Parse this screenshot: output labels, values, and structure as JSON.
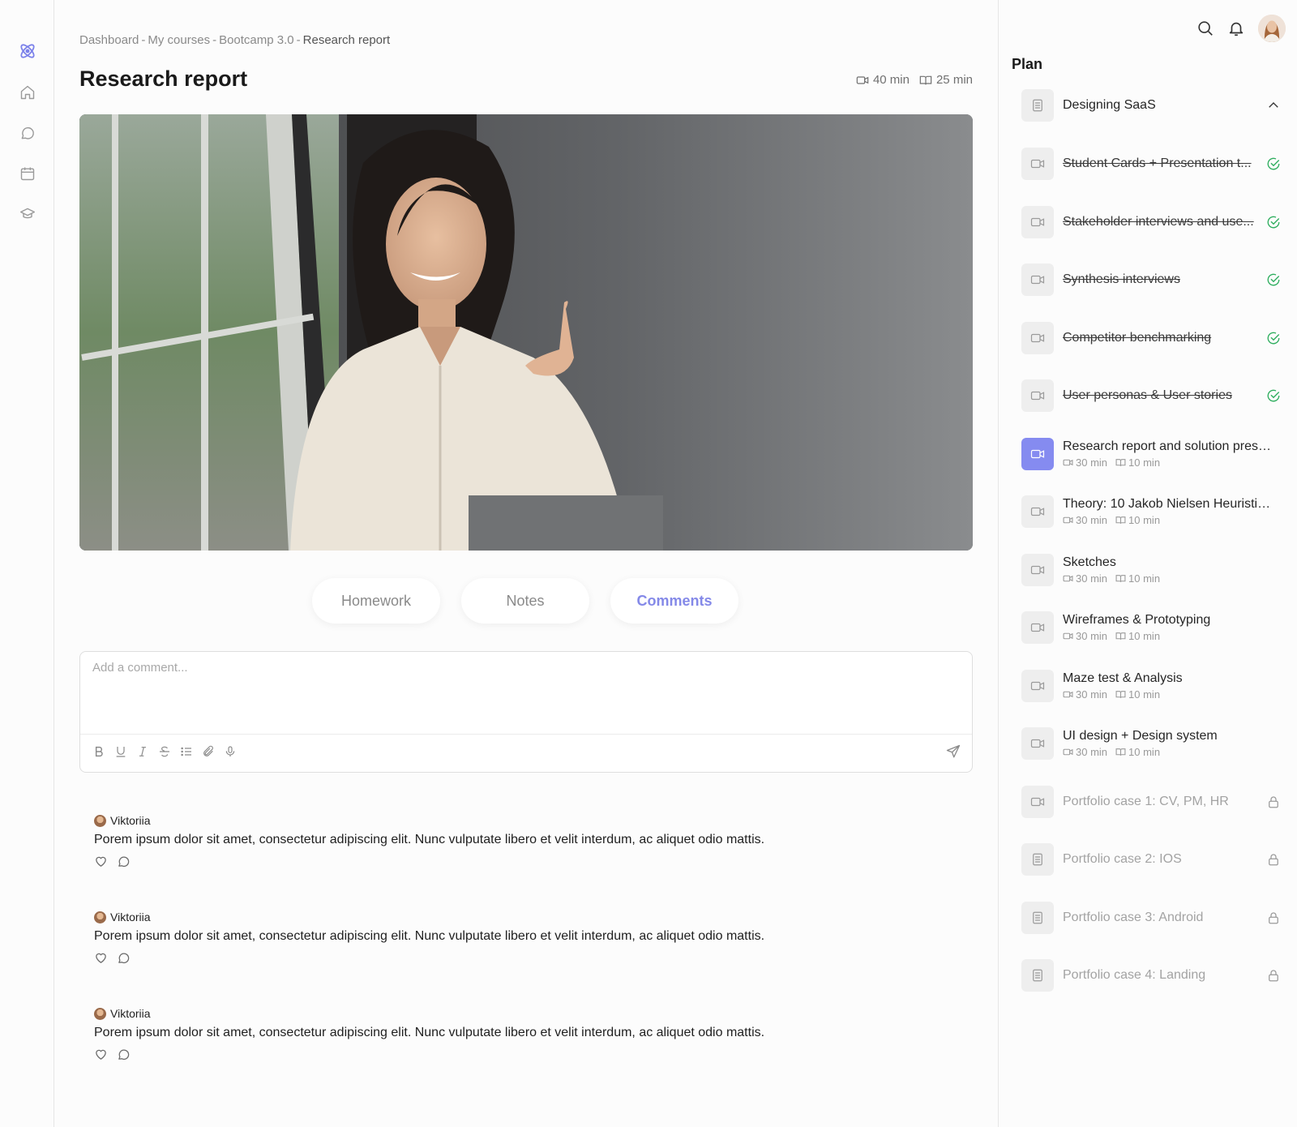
{
  "breadcrumb": {
    "items": [
      "Dashboard",
      "My courses",
      "Bootcamp 3.0"
    ],
    "current": "Research report",
    "separator": "-"
  },
  "lesson": {
    "title": "Research report",
    "video_duration": "40 min",
    "reading_duration": "25 min"
  },
  "tabs": [
    {
      "label": "Homework",
      "active": false
    },
    {
      "label": "Notes",
      "active": false
    },
    {
      "label": "Comments",
      "active": true
    }
  ],
  "comment_box": {
    "placeholder": "Add a comment..."
  },
  "comments": [
    {
      "author": "Viktoriia",
      "text": "Porem ipsum dolor sit amet, consectetur adipiscing elit. Nunc vulputate libero et velit interdum, ac aliquet odio mattis."
    },
    {
      "author": "Viktoriia",
      "text": "Porem ipsum dolor sit amet, consectetur adipiscing elit. Nunc vulputate libero et velit interdum, ac aliquet odio mattis."
    },
    {
      "author": "Viktoriia",
      "text": "Porem ipsum dolor sit amet, consectetur adipiscing elit. Nunc vulputate libero et velit interdum, ac aliquet odio mattis."
    }
  ],
  "plan": {
    "title": "Plan",
    "section": "Designing SaaS",
    "items": [
      {
        "title": "Student Cards + Presentation t...",
        "status": "done",
        "icon": "video-icon"
      },
      {
        "title": "Stakeholder interviews and use...",
        "status": "done",
        "icon": "video-icon"
      },
      {
        "title": "Synthesis interviews",
        "status": "done",
        "icon": "video-icon"
      },
      {
        "title": "Competitor benchmarking",
        "status": "done",
        "icon": "video-icon"
      },
      {
        "title": "User personas & User stories",
        "status": "done",
        "icon": "video-icon"
      },
      {
        "title": "Research report and solution prese...",
        "status": "active",
        "icon": "video-icon",
        "video": "30 min",
        "reading": "10 min"
      },
      {
        "title": "Theory: 10 Jakob Nielsen Heuristics...",
        "status": "open",
        "icon": "video-icon",
        "video": "30 min",
        "reading": "10 min"
      },
      {
        "title": "Sketches",
        "status": "open",
        "icon": "video-icon",
        "video": "30 min",
        "reading": "10 min"
      },
      {
        "title": "Wireframes & Prototyping",
        "status": "open",
        "icon": "video-icon",
        "video": "30 min",
        "reading": "10 min"
      },
      {
        "title": "Maze test & Analysis",
        "status": "open",
        "icon": "video-icon",
        "video": "30 min",
        "reading": "10 min"
      },
      {
        "title": "UI design + Design system",
        "status": "open",
        "icon": "video-icon",
        "video": "30 min",
        "reading": "10 min"
      },
      {
        "title": "Portfolio case 1: CV, PM, HR",
        "status": "locked",
        "icon": "video-icon"
      },
      {
        "title": "Portfolio case 2: IOS",
        "status": "locked",
        "icon": "document-icon"
      },
      {
        "title": "Portfolio case 3: Android",
        "status": "locked",
        "icon": "document-icon"
      },
      {
        "title": "Portfolio case 4: Landing",
        "status": "locked",
        "icon": "document-icon"
      }
    ]
  },
  "colors": {
    "accent": "#858bf0",
    "done_check": "#2fae5f",
    "muted": "#a3a3a3"
  }
}
